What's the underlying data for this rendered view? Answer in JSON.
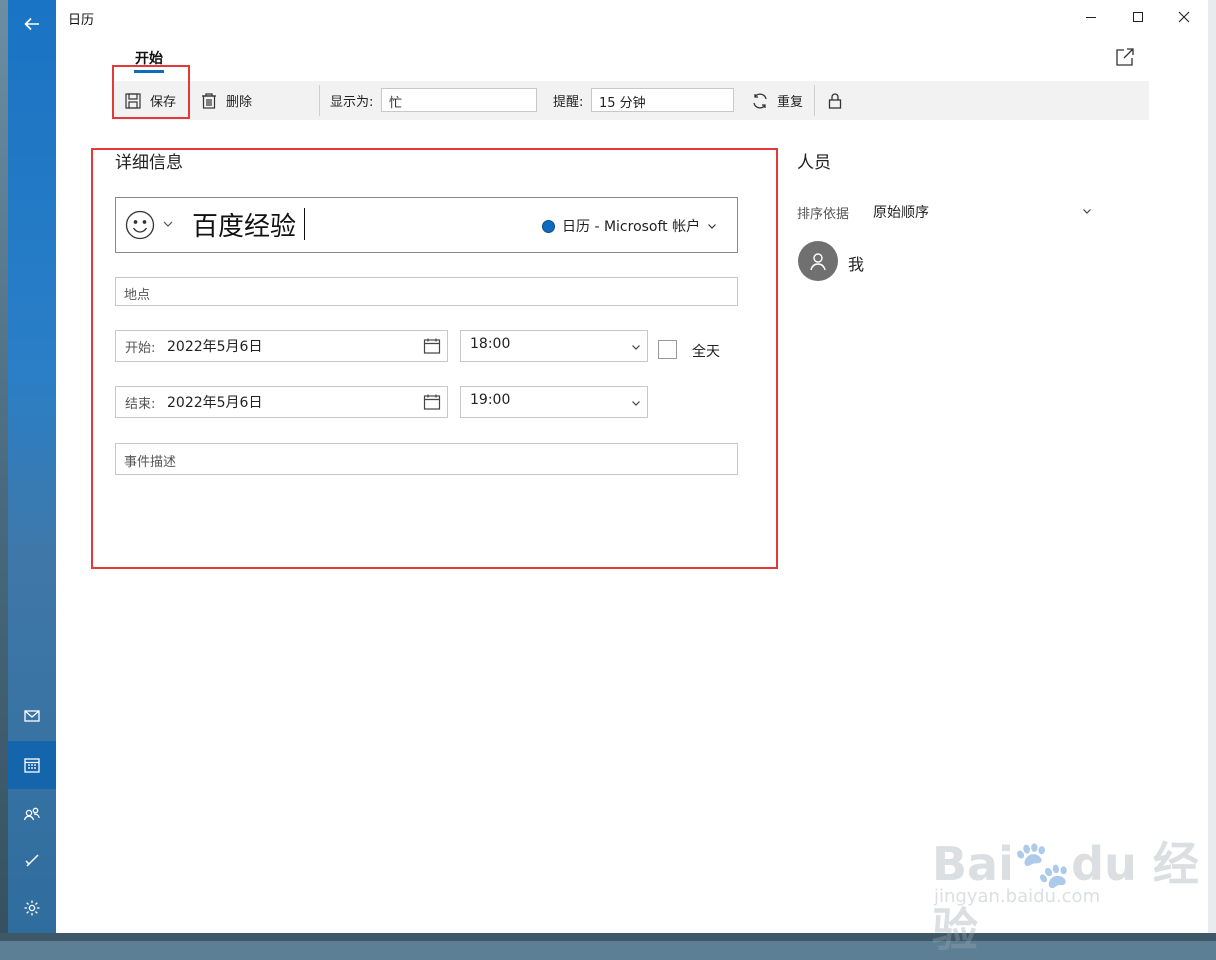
{
  "app": {
    "title": "日历"
  },
  "tabs": {
    "start_label": "开始"
  },
  "ribbon": {
    "save_label": "保存",
    "delete_label": "删除",
    "show_as_label": "显示为:",
    "show_as_value": "忙",
    "reminder_label": "提醒:",
    "reminder_value": "15 分钟",
    "repeat_label": "重复"
  },
  "details": {
    "section_title": "详细信息",
    "event_title": "百度经验",
    "calendar_name": "日历 - Microsoft 帐户",
    "calendar_color": "#0f6cbd",
    "location_placeholder": "地点",
    "start": {
      "label": "开始:",
      "date": "2022年5月6日",
      "time": "18:00"
    },
    "end": {
      "label": "结束:",
      "date": "2022年5月6日",
      "time": "19:00"
    },
    "all_day_label": "全天",
    "all_day_checked": false,
    "description_placeholder": "事件描述"
  },
  "people": {
    "section_title": "人员",
    "sort_label": "排序依据",
    "sort_value": "原始顺序",
    "attendees": [
      {
        "name": "我"
      }
    ]
  },
  "nav": {
    "items": [
      "mail-icon",
      "calendar-icon",
      "people-icon",
      "todo-icon",
      "settings-icon"
    ],
    "active": "calendar-icon"
  },
  "colors": {
    "accent": "#0f6cbd",
    "highlight": "#e5383b"
  }
}
